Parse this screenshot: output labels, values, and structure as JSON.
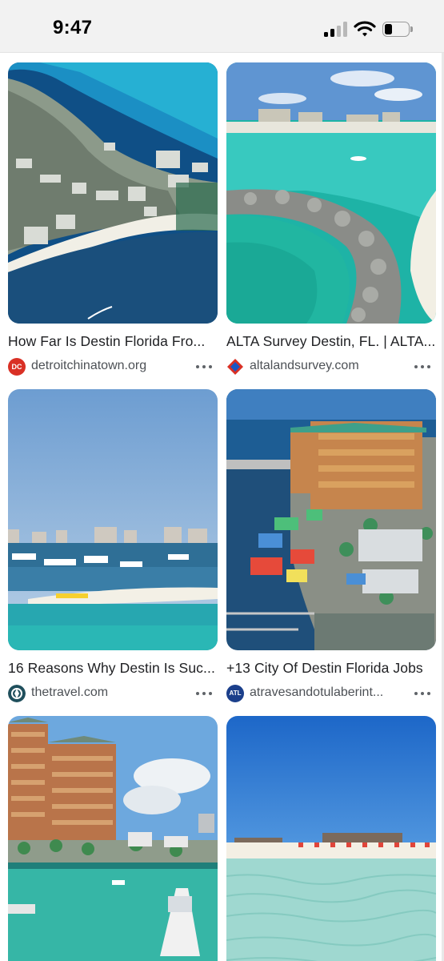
{
  "status_bar": {
    "time": "9:47",
    "icons": [
      "cellular-signal-icon",
      "wifi-icon",
      "battery-icon"
    ]
  },
  "results": [
    {
      "title": "How Far Is Destin Florida Fro...",
      "source": "detroitchinatown.org",
      "favicon_text": "DC",
      "favicon_color": "#d93025",
      "image": "aerial-destin-coastline"
    },
    {
      "title": "ALTA Survey Destin, FL. | ALTA...",
      "source": "altalandsurvey.com",
      "favicon_text": "",
      "favicon_color": "#1a56c4",
      "image": "destin-jetty-turquoise-water"
    },
    {
      "title": "16 Reasons Why Destin Is Suc...",
      "source": "thetravel.com",
      "favicon_text": "",
      "favicon_color": "#1f4f5c",
      "image": "destin-harbor-sandbar-boats"
    },
    {
      "title": "+13 City Of Destin Florida Jobs",
      "source": "atravesandotulaberint...",
      "favicon_text": "ATL",
      "favicon_color": "#1b3f8b",
      "image": "destin-harbor-resort-aerial"
    },
    {
      "title": "",
      "source": "",
      "favicon_text": "",
      "favicon_color": "",
      "image": "resort-towers-marina-yacht"
    },
    {
      "title": "",
      "source": "",
      "favicon_text": "",
      "favicon_color": "",
      "image": "clear-water-beach-umbrellas"
    }
  ],
  "more_options_icon": "more-horizontal-icon"
}
